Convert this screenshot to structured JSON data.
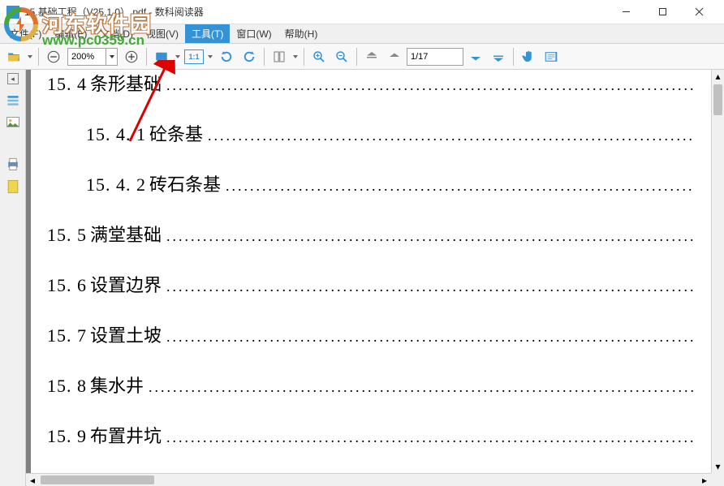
{
  "window": {
    "title": "15.基础工程（V25.1.0）.pdf - 数科阅读器"
  },
  "menu": {
    "file": "文件(F)",
    "edit": "编辑(E)",
    "document": "文档(D)",
    "view": "视图(V)",
    "tools": "工具(T)",
    "window": "窗口(W)",
    "help": "帮助(H)"
  },
  "toolbar": {
    "zoom_value": "200%",
    "ratio_label": "1:1",
    "page_value": "1/17"
  },
  "watermark": {
    "site_name": "河东软件园",
    "site_url": "www.pc0359.cn"
  },
  "toc": [
    {
      "num": "15. 4",
      "text": "条形基础",
      "sub": false,
      "first": true
    },
    {
      "num": "15. 4. 1",
      "text": "砼条基",
      "sub": true
    },
    {
      "num": "15. 4. 2",
      "text": "砖石条基",
      "sub": true
    },
    {
      "num": "15. 5",
      "text": "满堂基础",
      "sub": false
    },
    {
      "num": "15. 6",
      "text": "设置边界",
      "sub": false
    },
    {
      "num": "15. 7",
      "text": "设置土坡",
      "sub": false
    },
    {
      "num": "15. 8",
      "text": "集水井",
      "sub": false
    },
    {
      "num": "15. 9",
      "text": "布置井坑",
      "sub": false
    }
  ]
}
